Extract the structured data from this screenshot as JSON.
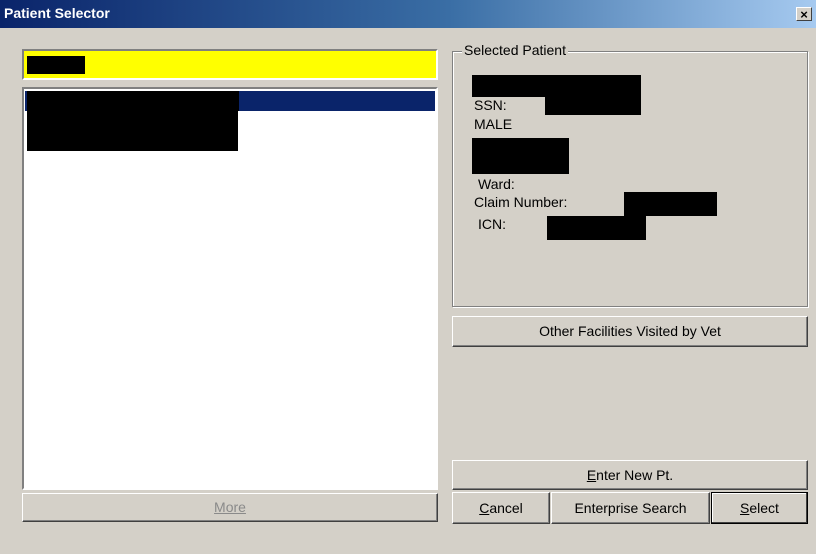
{
  "window": {
    "title": "Patient Selector",
    "close_label": "×"
  },
  "search": {
    "value": ""
  },
  "list": {
    "more_label": "More"
  },
  "selected_patient": {
    "group_label": "Selected Patient",
    "ssn_label": "SSN:",
    "sex": "MALE",
    "ward_label": "Ward:",
    "claim_label": "Claim Number:",
    "icn_label": "ICN:"
  },
  "buttons": {
    "other_facilities": "Other Facilities Visited by Vet",
    "enter_new_pt_key": "E",
    "enter_new_pt_rest": "nter New Pt.",
    "cancel_key": "C",
    "cancel_rest": "ancel",
    "enterprise_search": "Enterprise Search",
    "select_key": "S",
    "select_rest": "elect"
  },
  "colors": {
    "titlebar_start": "#0a246a",
    "titlebar_end": "#a6caf0",
    "search_bg": "#ffff00",
    "selection": "#0a246a",
    "window_bg": "#d4d0c8"
  }
}
